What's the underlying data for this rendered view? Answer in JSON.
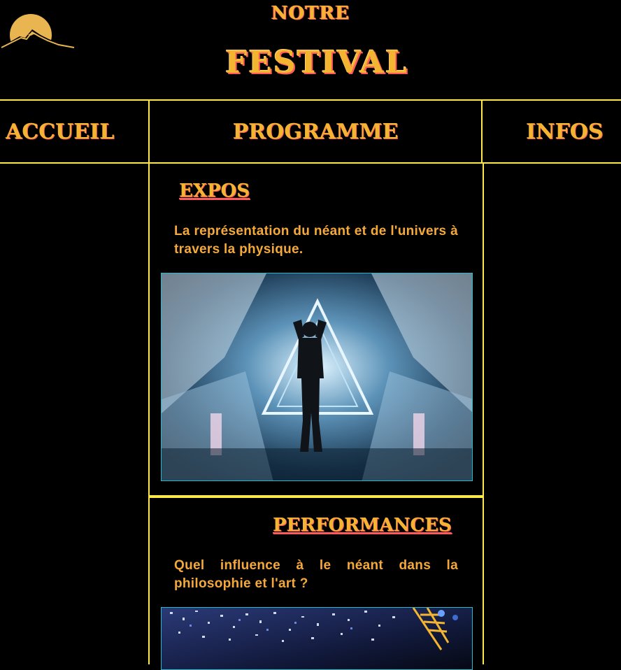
{
  "header": {
    "title_top": "NOTRE",
    "title_main": "FESTIVAL",
    "logo_icon": "mountain-sun-logo-icon"
  },
  "nav": {
    "accueil": "ACCUEIL",
    "programme": "PROGRAMME",
    "infos": "INFOS"
  },
  "sections": [
    {
      "title": "EXPOS",
      "text": "La représentation du néant et de l'univers à travers la physique.",
      "image": "person-in-mirror-tunnel-image"
    },
    {
      "title": "PERFORMANCES",
      "text": "Quel influence à le néant dans la philosophie et l'art ?",
      "image": "confetti-concert-image"
    }
  ],
  "colors": {
    "background": "#000000",
    "gold": "#f2b431",
    "accent_red": "#ff5a5a",
    "border_yellow": "#ffe84a",
    "text_orange": "#f5a93a",
    "image_border": "#2fb6c9"
  }
}
